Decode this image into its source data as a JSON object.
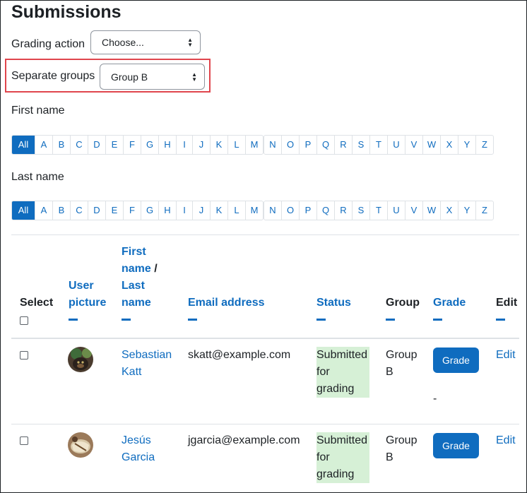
{
  "page_title": "Submissions",
  "grading_action": {
    "label": "Grading action",
    "value": "Choose..."
  },
  "separate_groups": {
    "label": "Separate groups",
    "value": "Group B"
  },
  "first_name_filter": {
    "label": "First name",
    "all": "All",
    "group1": [
      "A",
      "B",
      "C",
      "D",
      "E",
      "F",
      "G",
      "H",
      "I",
      "J",
      "K",
      "L",
      "M"
    ],
    "group2": [
      "N",
      "O",
      "P",
      "Q",
      "R",
      "S",
      "T",
      "U",
      "V",
      "W",
      "X",
      "Y",
      "Z"
    ]
  },
  "last_name_filter": {
    "label": "Last name",
    "all": "All",
    "group1": [
      "A",
      "B",
      "C",
      "D",
      "E",
      "F",
      "G",
      "H",
      "I",
      "J",
      "K",
      "L",
      "M"
    ],
    "group2": [
      "N",
      "O",
      "P",
      "Q",
      "R",
      "S",
      "T",
      "U",
      "V",
      "W",
      "X",
      "Y",
      "Z"
    ]
  },
  "table": {
    "headers": {
      "select": "Select",
      "user_picture_1": "User",
      "user_picture_2": "picture",
      "first_name_1": "First",
      "first_name_2": "name",
      "slash": " /",
      "last_name_1": "Last",
      "last_name_2": "name",
      "email": "Email address",
      "status": "Status",
      "group": "Group",
      "grade": "Grade",
      "edit": "Edit"
    },
    "rows": [
      {
        "first": "Sebastian",
        "last": "Katt",
        "email": "skatt@example.com",
        "status_1": "Submitted",
        "status_2": "for",
        "status_3": "grading",
        "group_1": "Group",
        "group_2": "B",
        "grade_button": "Grade",
        "grade_value": "-",
        "edit": "Edit"
      },
      {
        "first": "Jesús",
        "last": "Garcia",
        "email": "jgarcia@example.com",
        "status_1": "Submitted",
        "status_2": "for",
        "status_3": "grading",
        "group_1": "Group",
        "group_2": "B",
        "grade_button": "Grade",
        "grade_value": "",
        "edit": "Edit"
      }
    ]
  }
}
